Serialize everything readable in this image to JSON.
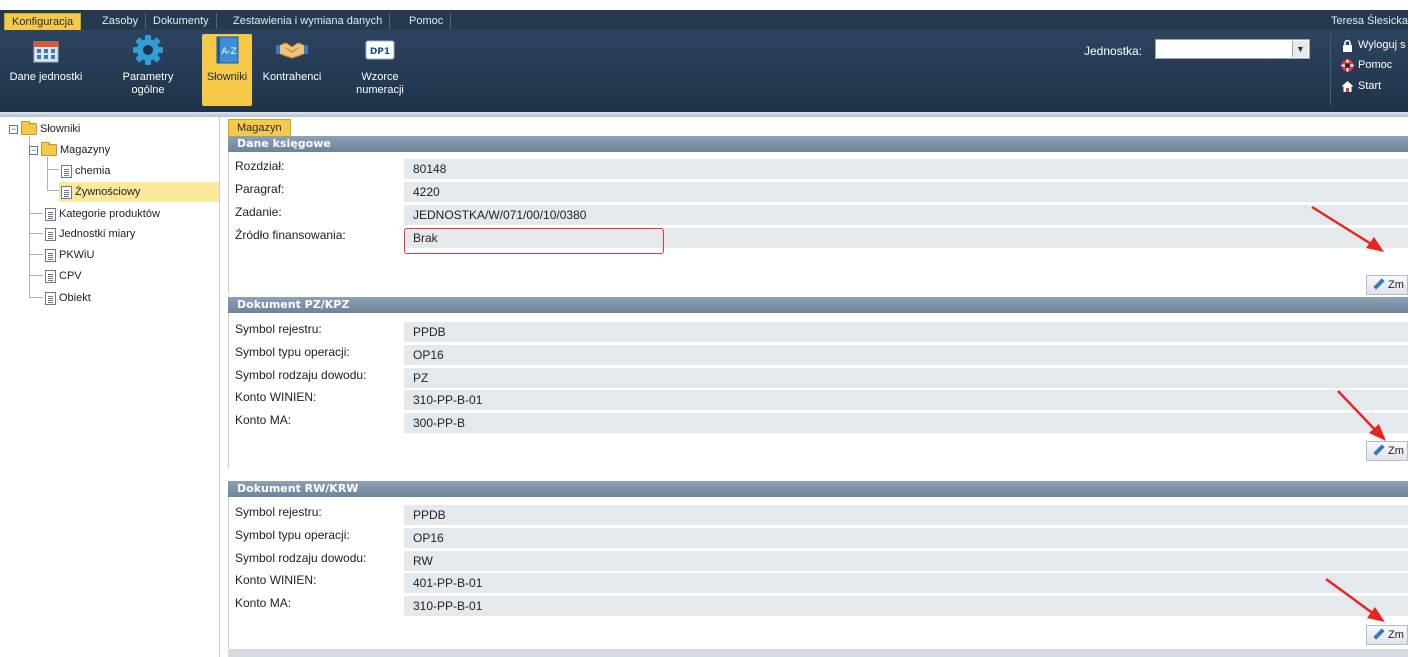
{
  "menu": {
    "tabs": [
      "Konfiguracja",
      "Zasoby",
      "Dokumenty",
      "Zestawienia i wymiana danych",
      "Pomoc"
    ],
    "user": "Teresa Ślesicka"
  },
  "toolbar": {
    "buttons": [
      {
        "label": "Dane jednostki",
        "icon": "building-icon"
      },
      {
        "label": "Parametry\nogólne",
        "icon": "gear-icon"
      },
      {
        "label": "Słowniki",
        "icon": "dictionary-icon"
      },
      {
        "label": "Kontrahenci",
        "icon": "handshake-icon"
      },
      {
        "label": "Wzorce\nnumeracji",
        "icon": "numbering-icon",
        "icon_text": "DP1"
      }
    ],
    "unit_label": "Jednostka:",
    "unit_value": "",
    "links": [
      {
        "label": "Wyloguj s",
        "icon": "lock-icon"
      },
      {
        "label": "Pomoc",
        "icon": "lifebuoy-icon"
      },
      {
        "label": "Start",
        "icon": "home-icon"
      }
    ]
  },
  "tree": {
    "items": [
      {
        "label": "Słowniki",
        "type": "folder"
      },
      {
        "label": "Magazyny",
        "type": "folder"
      },
      {
        "label": "chemia",
        "type": "doc"
      },
      {
        "label": "Żywnościowy",
        "type": "doc",
        "selected": true
      },
      {
        "label": "Kategorie produktów",
        "type": "doc"
      },
      {
        "label": "Jednostki miary",
        "type": "doc"
      },
      {
        "label": "PKWiU",
        "type": "doc"
      },
      {
        "label": "CPV",
        "type": "doc"
      },
      {
        "label": "Obiekt",
        "type": "doc"
      }
    ]
  },
  "main": {
    "tab": "Magazyn",
    "edit_label": "Zm",
    "panels": [
      {
        "title": "Dane księgowe",
        "rows": [
          {
            "label": "Rozdział:",
            "value": "80148"
          },
          {
            "label": "Paragraf:",
            "value": "4220"
          },
          {
            "label": "Zadanie:",
            "value": "JEDNOSTKA/W/071/00/10/0380"
          },
          {
            "label": "Źródło finansowania:",
            "value": "Brak"
          }
        ]
      },
      {
        "title": "Dokument PZ/KPZ",
        "rows": [
          {
            "label": "Symbol rejestru:",
            "value": "PPDB"
          },
          {
            "label": "Symbol typu operacji:",
            "value": "OP16"
          },
          {
            "label": "Symbol rodzaju dowodu:",
            "value": "PZ"
          },
          {
            "label": "Konto WINIEN:",
            "value": "310-PP-B-01"
          },
          {
            "label": "Konto MA:",
            "value": "300-PP-B"
          }
        ]
      },
      {
        "title": "Dokument RW/KRW",
        "rows": [
          {
            "label": "Symbol rejestru:",
            "value": "PPDB"
          },
          {
            "label": "Symbol typu operacji:",
            "value": "OP16"
          },
          {
            "label": "Symbol rodzaju dowodu:",
            "value": "RW"
          },
          {
            "label": "Konto WINIEN:",
            "value": "401-PP-B-01"
          },
          {
            "label": "Konto MA:",
            "value": "310-PP-B-01"
          }
        ]
      }
    ]
  },
  "colors": {
    "accent": "#f7c948",
    "toolbar": "#25394f",
    "panel_header": "#7a8fa5",
    "highlight": "#e03a3a"
  }
}
